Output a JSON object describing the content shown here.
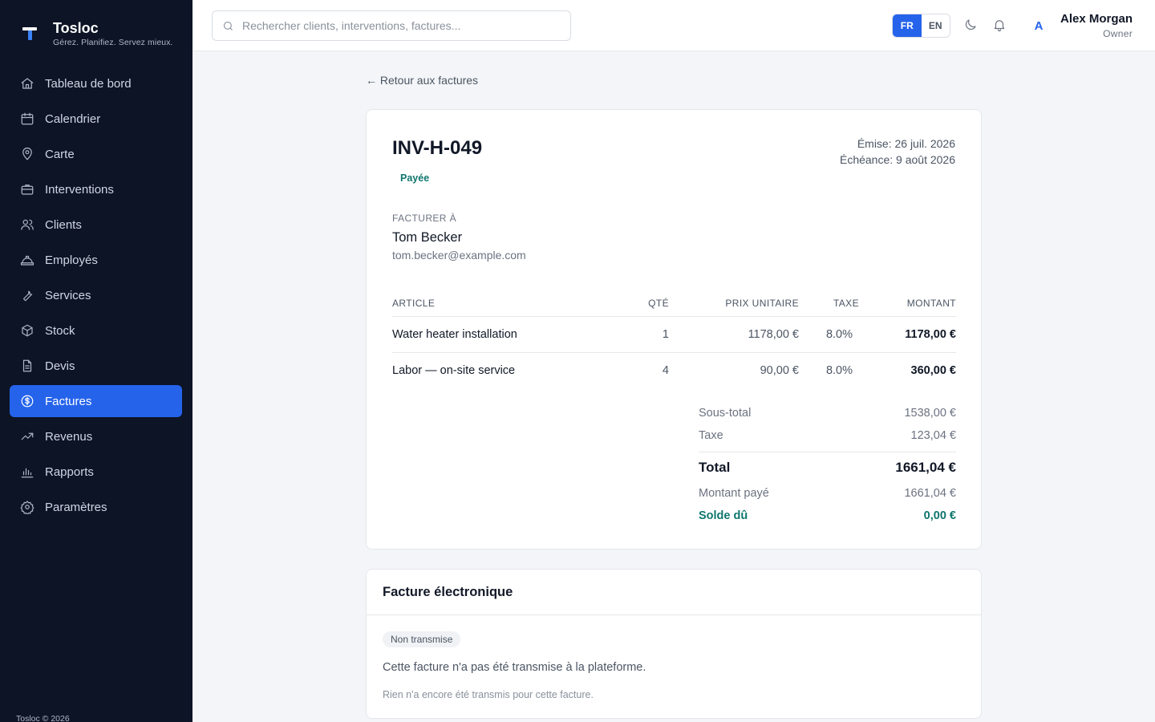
{
  "app": {
    "name": "Tosloc",
    "tagline": "Gérez. Planifiez. Servez mieux.",
    "footer": "Tosloc © 2026"
  },
  "nav": [
    {
      "label": "Tableau de bord",
      "icon": "home-icon",
      "active": false
    },
    {
      "label": "Calendrier",
      "icon": "calendar-icon",
      "active": false
    },
    {
      "label": "Carte",
      "icon": "map-pin-icon",
      "active": false
    },
    {
      "label": "Interventions",
      "icon": "briefcase-icon",
      "active": false
    },
    {
      "label": "Clients",
      "icon": "users-icon",
      "active": false
    },
    {
      "label": "Employés",
      "icon": "hard-hat-icon",
      "active": false
    },
    {
      "label": "Services",
      "icon": "wrench-icon",
      "active": false
    },
    {
      "label": "Stock",
      "icon": "box-icon",
      "active": false
    },
    {
      "label": "Devis",
      "icon": "file-icon",
      "active": false
    },
    {
      "label": "Factures",
      "icon": "dollar-circle-icon",
      "active": true
    },
    {
      "label": "Revenus",
      "icon": "trending-up-icon",
      "active": false
    },
    {
      "label": "Rapports",
      "icon": "bar-chart-icon",
      "active": false
    },
    {
      "label": "Paramètres",
      "icon": "gear-icon",
      "active": false
    }
  ],
  "topbar": {
    "search_placeholder": "Rechercher clients, interventions, factures...",
    "lang_fr": "FR",
    "lang_en": "EN",
    "lang_active": "FR",
    "avatar_initial": "A",
    "user_name": "Alex Morgan",
    "user_role": "Owner"
  },
  "back_link": "← Retour aux factures",
  "invoice": {
    "number": "INV-H-049",
    "status": "Payée",
    "issued": "Émise: 26 juil. 2026",
    "due": "Échéance: 9 août 2026",
    "bill_to_label": "FACTURER À",
    "client_name": "Tom Becker",
    "client_email": "tom.becker@example.com",
    "columns": {
      "article": "ARTICLE",
      "qty": "QTÉ",
      "unit_price": "PRIX UNITAIRE",
      "tax": "TAXE",
      "amount": "MONTANT"
    },
    "items": [
      {
        "article": "Water heater installation",
        "qty": "1",
        "unit_price": "1178,00 €",
        "tax": "8.0%",
        "amount": "1178,00 €"
      },
      {
        "article": "Labor — on-site service",
        "qty": "4",
        "unit_price": "90,00 €",
        "tax": "8.0%",
        "amount": "360,00 €"
      }
    ],
    "totals": {
      "subtotal_label": "Sous-total",
      "subtotal": "1538,00 €",
      "tax_label": "Taxe",
      "tax": "123,04 €",
      "total_label": "Total",
      "total": "1661,04 €",
      "paid_label": "Montant payé",
      "paid": "1661,04 €",
      "due_label": "Solde dû",
      "due": "0,00 €"
    }
  },
  "einvoice": {
    "title": "Facture électronique",
    "status": "Non transmise",
    "message": "Cette facture n'a pas été transmise à la plateforme.",
    "sub": "Rien n'a encore été transmis pour cette facture."
  },
  "colors": {
    "sidebar_bg": "#0d1426",
    "accent": "#2563eb",
    "success": "#0f766e"
  }
}
